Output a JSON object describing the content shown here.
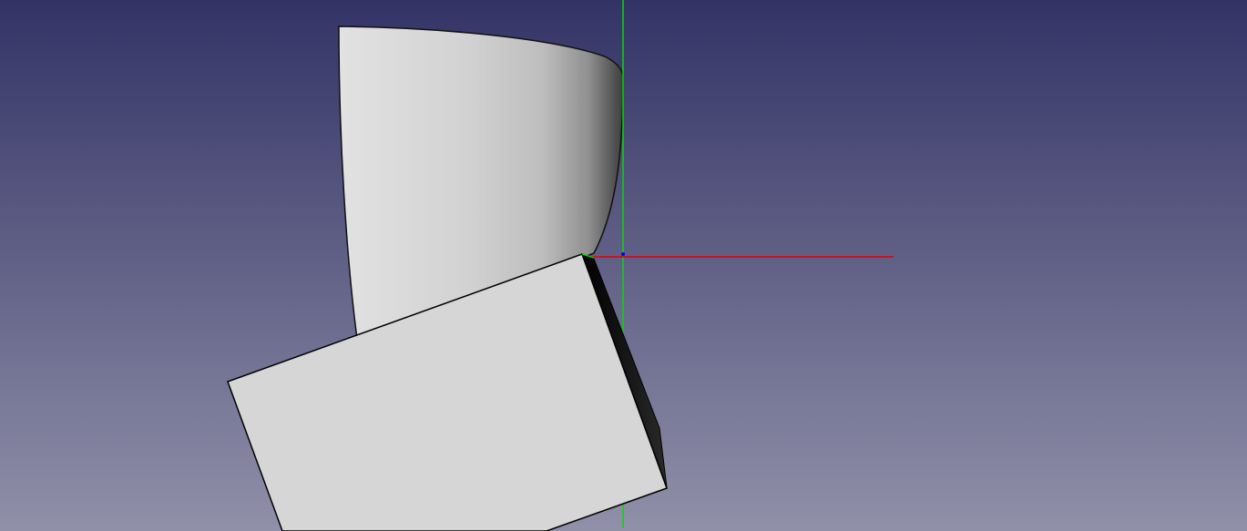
{
  "viewport": {
    "background_top": "#333366",
    "background_bottom": "#9090a9"
  },
  "axes": {
    "x_axis_color": "#e00000",
    "y_axis_color": "#00dd00",
    "z_axis_color": "#0000ff"
  },
  "shapes": [
    {
      "type": "curved-surface",
      "icon": "shaded-face"
    },
    {
      "type": "box",
      "icon": "cube"
    }
  ]
}
